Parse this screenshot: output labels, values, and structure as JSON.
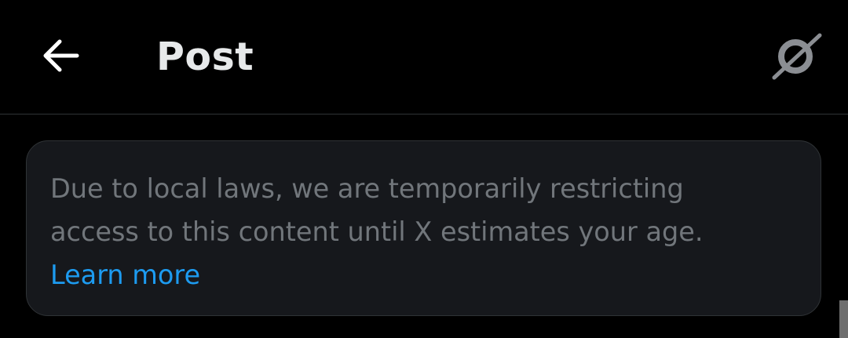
{
  "header": {
    "title": "Post",
    "back_icon": "arrow-left-icon",
    "action_icon": "grok-icon"
  },
  "notice": {
    "lines": [
      "Due to local laws, we are temporarily restricting",
      "access to this content until X estimates your age."
    ],
    "link_label": "Learn more"
  },
  "colors": {
    "background": "#000000",
    "title_text": "#e7e9ea",
    "notice_bg": "#16181c",
    "notice_border": "#2f3336",
    "notice_text": "#71767b",
    "link": "#1d9bf0",
    "divider": "#2f3336"
  }
}
